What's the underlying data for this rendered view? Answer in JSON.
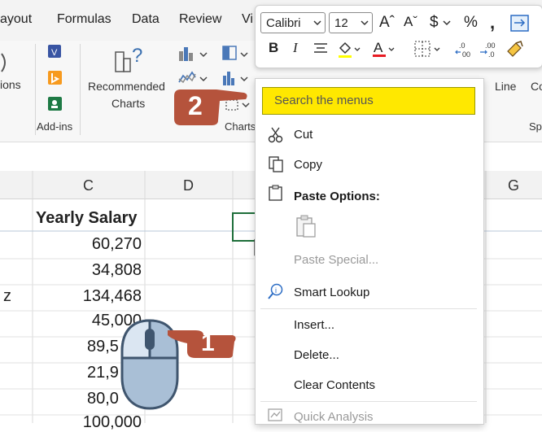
{
  "ribbon": {
    "tabs": [
      "ayout",
      "Formulas",
      "Data",
      "Review",
      "Vi"
    ],
    "left_partial_label": "ions",
    "addins_label": "Add-ins",
    "recommended_charts_line1": "Recommended",
    "recommended_charts_line2": "Charts",
    "charts_group_label": "Charts",
    "right_labels": [
      "Line",
      "Co",
      "Sp"
    ]
  },
  "mini_toolbar": {
    "font_name": "Calibri",
    "font_size": "12",
    "bold": "B",
    "italic": "I",
    "currency": "$",
    "percent": "%",
    "comma": "ɑ"
  },
  "sheet": {
    "columns": [
      "C",
      "D",
      "G"
    ],
    "header_cell": "Yearly Salary",
    "partial_left_cell": "z",
    "values": [
      "60,270",
      "34,808",
      "134,468",
      "45,000",
      "89,5",
      "21,9",
      "80,0",
      "100,000"
    ]
  },
  "context_menu": {
    "search_placeholder": "Search the menus",
    "items": [
      "Cut",
      "Copy",
      "Paste Options:",
      "Paste Special...",
      "Smart Lookup",
      "Insert...",
      "Delete...",
      "Clear Contents",
      "Quick Analysis"
    ]
  },
  "callouts": {
    "step1": "1",
    "step2": "2"
  },
  "colors": {
    "search_highlight": "#ffe800",
    "callout": "#b5533c",
    "mouse": "#9ab3cc"
  }
}
